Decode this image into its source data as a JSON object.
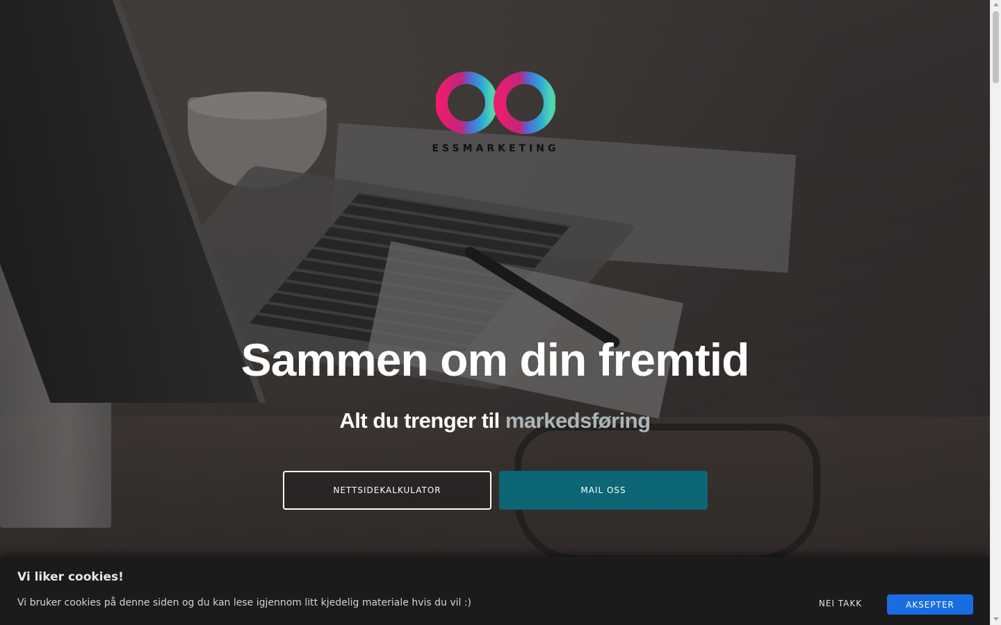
{
  "brand": {
    "name": "ESSMARKETING",
    "icon": "infinity-logo-icon",
    "gradient": [
      "#ec1c6f",
      "#6d5bd0",
      "#2aa6d8",
      "#4fd3b0"
    ]
  },
  "hero": {
    "title": "Sammen om din fremtid",
    "subtitle_prefix": "Alt du trenger til ",
    "subtitle_accent": "markedsføring",
    "accent_color": "#a9b5b8"
  },
  "buttons": {
    "calculator": "NETTSIDEKALKULATOR",
    "mail": "MAIL OSS",
    "mail_color": "#0c6675"
  },
  "cookie_banner": {
    "title": "Vi liker cookies!",
    "text": "Vi bruker cookies på denne siden og du kan lese igjennom litt kjedelig materiale hvis du vil :)",
    "decline": "NEI TAKK",
    "accept": "AKSEPTER",
    "accept_color": "#1a6de0"
  },
  "scrollbar": {
    "up_icon": "arrow-up-icon",
    "down_icon": "arrow-down-icon"
  }
}
